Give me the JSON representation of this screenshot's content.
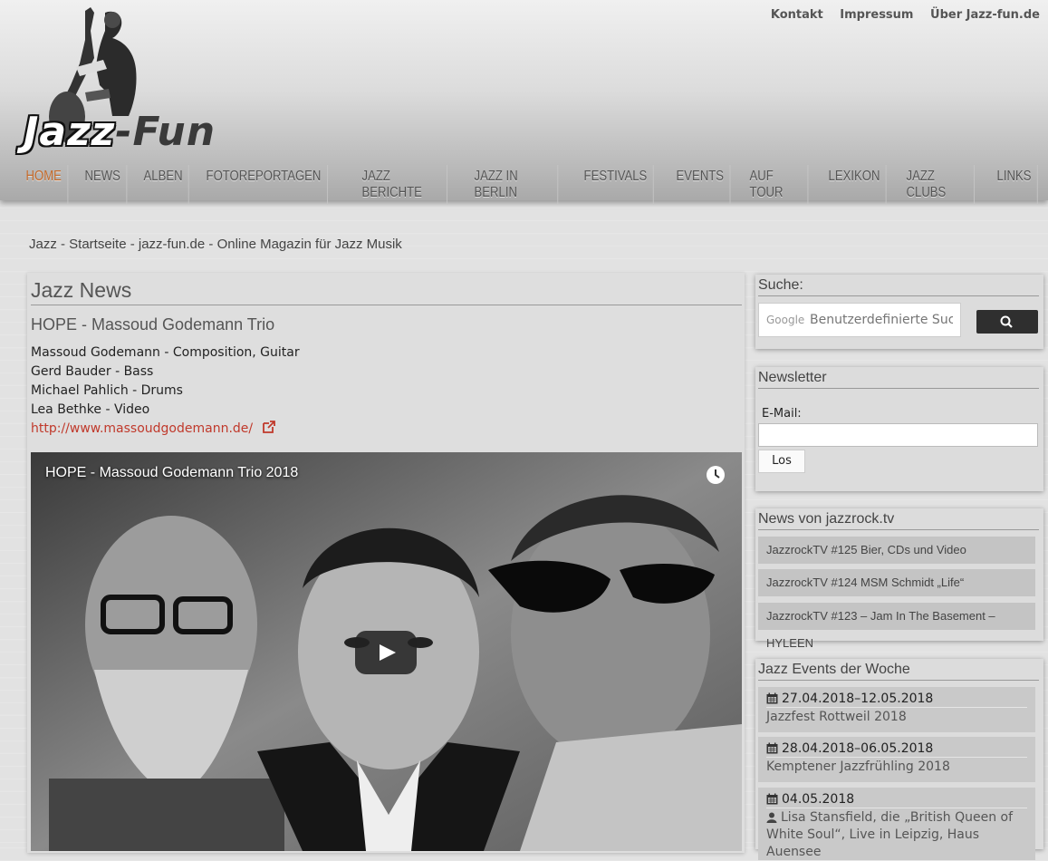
{
  "header": {
    "top_links": [
      "Kontakt",
      "Impressum",
      "Über Jazz-fun.de"
    ],
    "logo_text": {
      "part1": "Jazz",
      "dash": "-",
      "part2": "Fun"
    }
  },
  "nav": {
    "items": [
      "HOME",
      "NEWS",
      "ALBEN",
      "FOTOREPORTAGEN",
      "JAZZ BERICHTE",
      "JAZZ IN BERLIN",
      "FESTIVALS",
      "EVENTS",
      "AUF TOUR",
      "LEXIKON",
      "JAZZ CLUBS",
      "LINKS"
    ],
    "active": "HOME"
  },
  "breadcrumb": "Jazz - Startseite - jazz-fun.de - Online Magazin für Jazz Musik",
  "main": {
    "title": "Jazz News",
    "article": {
      "title": "HOPE - Massoud Godemann Trio",
      "credits": [
        "Massoud Godemann - Composition, Guitar",
        "Gerd Bauder - Bass",
        "Michael Pahlich - Drums",
        "Lea Bethke - Video"
      ],
      "link": "http://www.massoudgodemann.de/",
      "video_title": "HOPE - Massoud Godemann Trio 2018"
    }
  },
  "sidebar": {
    "search": {
      "heading": "Suche:",
      "google_label": "Google",
      "placeholder": "Benutzerdefinierte Such"
    },
    "newsletter": {
      "heading": "Newsletter",
      "email_label": "E-Mail:",
      "button": "Los"
    },
    "jazzrock": {
      "heading": "News von jazzrock.tv",
      "items": [
        "JazzrockTV #125 Bier, CDs und Video",
        "JazzrockTV #124 MSM Schmidt „Life“",
        "JazzrockTV #123 – Jam In The Basement – HYLEEN"
      ]
    },
    "events": {
      "heading": "Jazz Events der Woche",
      "items": [
        {
          "date": "27.04.2018–12.05.2018",
          "title": "Jazzfest Rottweil 2018"
        },
        {
          "date": "28.04.2018–06.05.2018",
          "title": "Kemptener Jazzfrühling 2018"
        },
        {
          "date": "04.05.2018",
          "title": "Lisa Stansfield, die „British Queen of White Soul“, Live in Leipzig, Haus Auensee"
        }
      ]
    }
  },
  "colors": {
    "accent": "#c46a2b",
    "link": "#c0392b"
  }
}
